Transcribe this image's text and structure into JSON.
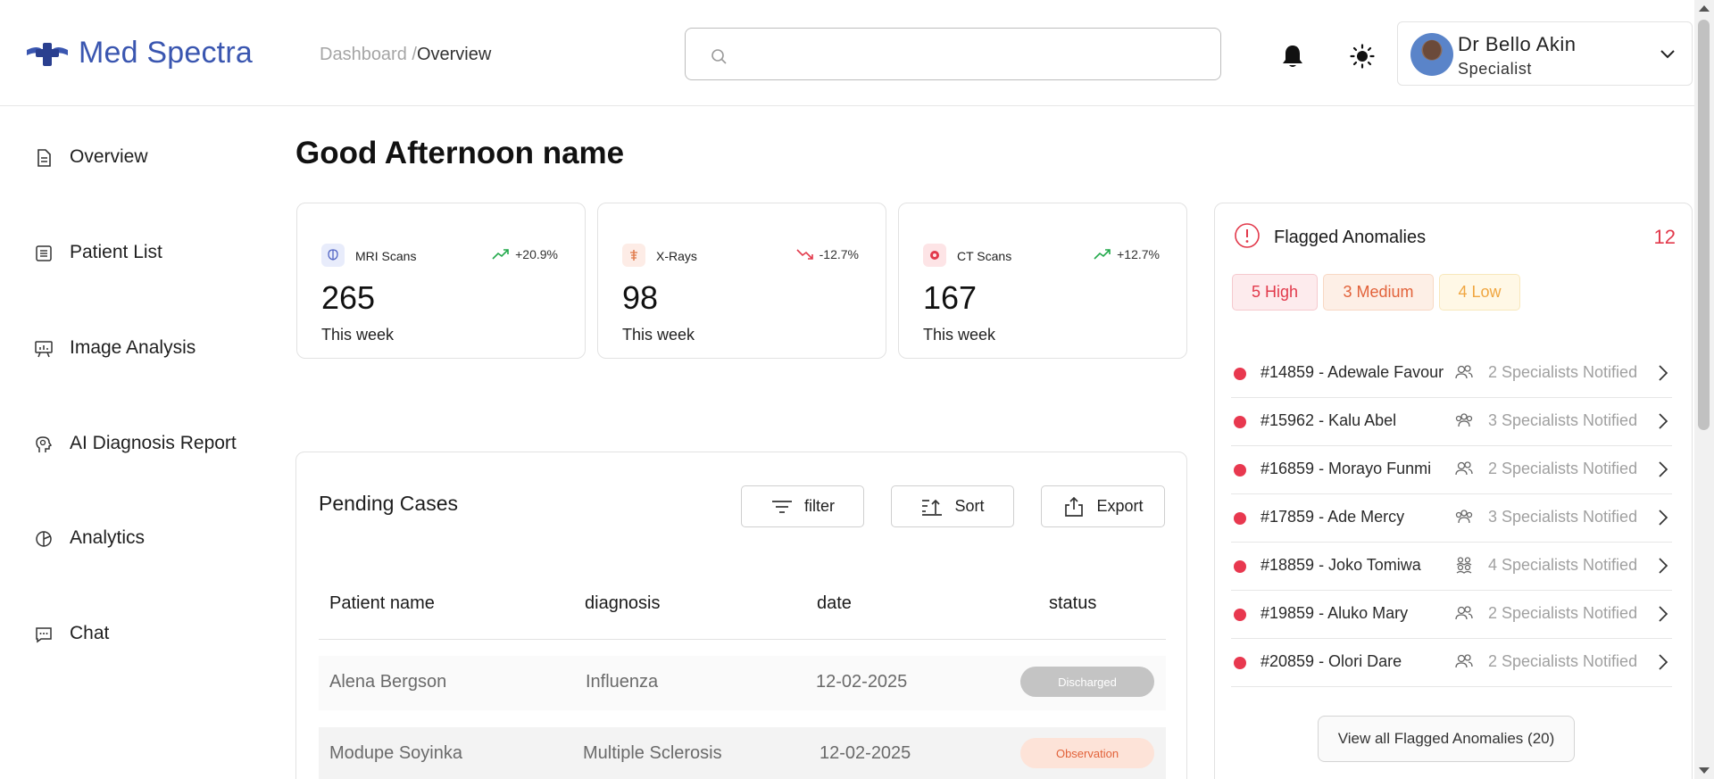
{
  "app": {
    "name": "Med Spectra",
    "brand_color": "#3a56b0"
  },
  "breadcrumb": {
    "parent": "Dashboard /",
    "current": "Overview"
  },
  "search": {
    "placeholder": ""
  },
  "user": {
    "name": "Dr Bello Akin",
    "role": "Specialist"
  },
  "sidebar": {
    "items": [
      {
        "label": "Overview",
        "icon": "document-icon"
      },
      {
        "label": "Patient List",
        "icon": "list-icon"
      },
      {
        "label": "Image Analysis",
        "icon": "presentation-chart-icon"
      },
      {
        "label": "AI Diagnosis Report",
        "icon": "brain-head-icon"
      },
      {
        "label": "Analytics",
        "icon": "pie-chart-icon"
      },
      {
        "label": "Chat",
        "icon": "chat-bubble-icon"
      }
    ]
  },
  "greeting": "Good Afternoon name",
  "stats": [
    {
      "title": "MRI Scans",
      "trend": "+20.9%",
      "direction": "up",
      "value": "265",
      "sub": "This week",
      "icon": "brain-icon",
      "color": "#22a94b"
    },
    {
      "title": "X-Rays",
      "trend": "-12.7%",
      "direction": "down",
      "value": "98",
      "sub": "This week",
      "icon": "skeleton-icon",
      "color": "#e2394b"
    },
    {
      "title": "CT Scans",
      "trend": "+12.7%",
      "direction": "up",
      "value": "167",
      "sub": "This week",
      "icon": "scan-icon",
      "color": "#22a94b"
    }
  ],
  "pending": {
    "title": "Pending Cases",
    "buttons": {
      "filter": "filter",
      "sort": "Sort",
      "export": "Export"
    },
    "columns": [
      "Patient name",
      "diagnosis",
      "date",
      "status"
    ],
    "rows": [
      {
        "name": "Alena Bergson",
        "diagnosis": "Influenza",
        "date": "12-02-2025",
        "status": "Discharged"
      },
      {
        "name": "Modupe Soyinka",
        "diagnosis": "Multiple Sclerosis",
        "date": "12-02-2025",
        "status": "Observation"
      }
    ]
  },
  "flagged": {
    "title": "Flagged Anomalies",
    "count": "12",
    "pills": {
      "high": "5 High",
      "medium": "3 Medium",
      "low": "4 Low"
    },
    "items": [
      {
        "label": "#14859 - Adewale Favour",
        "notified": "2 Specialists Notified"
      },
      {
        "label": "#15962 - Kalu Abel",
        "notified": "3 Specialists Notified"
      },
      {
        "label": "#16859 - Morayo Funmi",
        "notified": "2 Specialists Notified"
      },
      {
        "label": "#17859 - Ade Mercy",
        "notified": "3 Specialists Notified"
      },
      {
        "label": "#18859 - Joko Tomiwa",
        "notified": "4 Specialists Notified"
      },
      {
        "label": "#19859 - Aluko Mary",
        "notified": "2 Specialists Notified"
      },
      {
        "label": "#20859 - Olori Dare",
        "notified": "2 Specialists Notified"
      }
    ],
    "view_all": "View all Flagged Anomalies (20)"
  }
}
